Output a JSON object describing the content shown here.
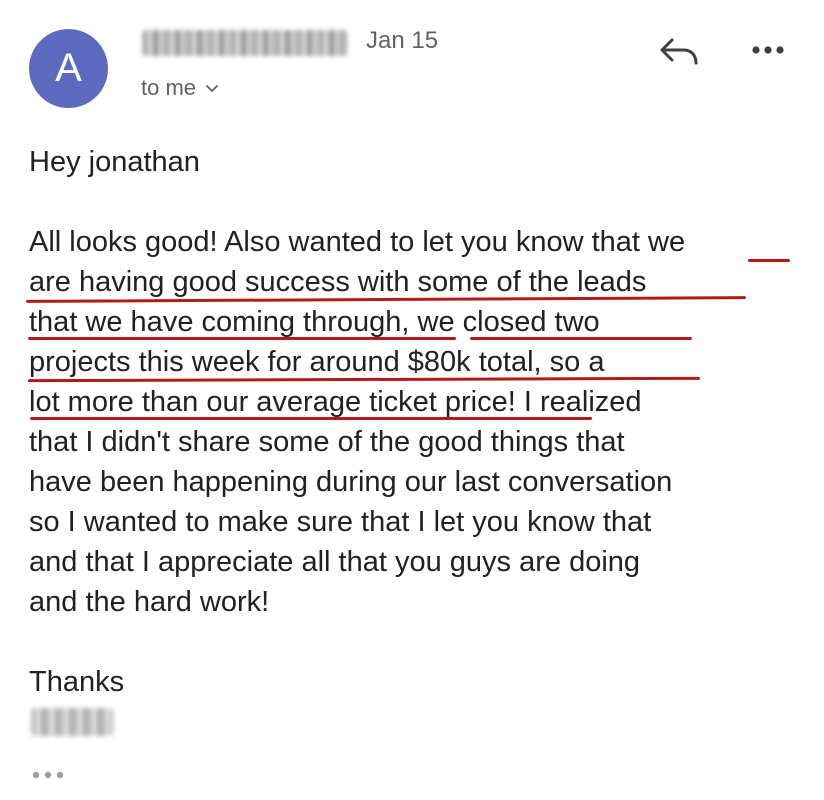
{
  "header": {
    "avatar_letter": "A",
    "date": "Jan 15",
    "recipient": "to me",
    "icons": [
      "reply-icon",
      "more-vert-icon",
      "chevron-down-icon"
    ]
  },
  "body": {
    "lines": [
      "Hey jonathan",
      "",
      "All looks good! Also wanted to let you know that we",
      "are having good success with some of the leads",
      "that we have coming through, we closed two",
      "projects this week for around $80k total, so a",
      "lot more than our average ticket price! I realized",
      "that I didn't share some of the good things that",
      "have been happening during our last conversation",
      "so I wanted to make sure that I let you know that",
      "and that I appreciate all that you guys are doing",
      "and the hard work!",
      "",
      "Thanks"
    ],
    "annotation_color": "#b31b1b"
  },
  "footer": {
    "icons": [
      "trimmed-content-icon"
    ]
  }
}
